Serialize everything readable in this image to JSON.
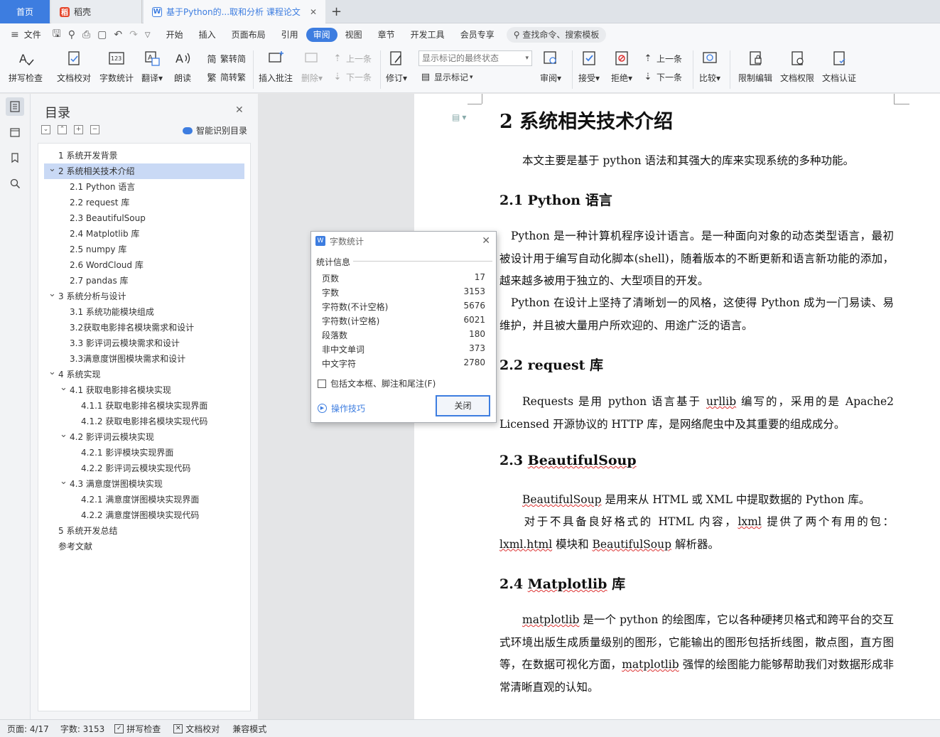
{
  "tabs": {
    "home": "首页",
    "tab1": "稻壳",
    "tab2": "基于Python的...取和分析 课程论文"
  },
  "menu": {
    "file": "文件",
    "items": [
      "开始",
      "插入",
      "页面布局",
      "引用",
      "审阅",
      "视图",
      "章节",
      "开发工具",
      "会员专享"
    ],
    "search": "查找命令、搜索模板"
  },
  "ribbon": {
    "spellcheck": "拼写检查",
    "doccheck": "文档校对",
    "wordcount": "字数统计",
    "translate": "翻译",
    "read": "朗读",
    "trad": "繁转简",
    "simp": "简转繁",
    "insert_comment": "插入批注",
    "delete": "删除",
    "prev": "上一条",
    "next": "下一条",
    "revise": "修订",
    "markup_select": "显示标记的最终状态",
    "show_markup": "显示标记",
    "review": "审阅",
    "accept": "接受",
    "reject": "拒绝",
    "prev2": "上一条",
    "next2": "下一条",
    "compare": "比较",
    "restrict": "限制编辑",
    "permission": "文档权限",
    "certify": "文档认证"
  },
  "toc": {
    "title": "目录",
    "smart": "智能识别目录",
    "items": [
      {
        "label": "1 系统开发背景",
        "level": 0,
        "chev": false
      },
      {
        "label": "2 系统相关技术介绍",
        "level": 0,
        "chev": true,
        "selected": true
      },
      {
        "label": "2.1 Python 语言",
        "level": 1,
        "chev": false
      },
      {
        "label": "2.2 request 库",
        "level": 1,
        "chev": false
      },
      {
        "label": "2.3 BeautifulSoup",
        "level": 1,
        "chev": false
      },
      {
        "label": "2.4 Matplotlib 库",
        "level": 1,
        "chev": false
      },
      {
        "label": "2.5 numpy 库",
        "level": 1,
        "chev": false
      },
      {
        "label": "2.6 WordCloud 库",
        "level": 1,
        "chev": false
      },
      {
        "label": "2.7 pandas 库",
        "level": 1,
        "chev": false
      },
      {
        "label": "3 系统分析与设计",
        "level": 0,
        "chev": true
      },
      {
        "label": "3.1 系统功能模块组成",
        "level": 1,
        "chev": false
      },
      {
        "label": "3.2获取电影排名模块需求和设计",
        "level": 1,
        "chev": false
      },
      {
        "label": "3.3 影评词云模块需求和设计",
        "level": 1,
        "chev": false
      },
      {
        "label": "3.3满意度饼图模块需求和设计",
        "level": 1,
        "chev": false
      },
      {
        "label": "4 系统实现",
        "level": 0,
        "chev": true
      },
      {
        "label": "4.1  获取电影排名模块实现",
        "level": 1,
        "chev": true
      },
      {
        "label": "4.1.1  获取电影排名模块实现界面",
        "level": 2,
        "chev": false
      },
      {
        "label": "4.1.2  获取电影排名模块实现代码",
        "level": 2,
        "chev": false
      },
      {
        "label": "4.2  影评词云模块实现",
        "level": 1,
        "chev": true
      },
      {
        "label": "4.2.1  影评模块实现界面",
        "level": 2,
        "chev": false
      },
      {
        "label": "4.2.2  影评词云模块实现代码",
        "level": 2,
        "chev": false
      },
      {
        "label": "4.3  满意度饼图模块实现",
        "level": 1,
        "chev": true
      },
      {
        "label": "4.2.1  满意度饼图模块实现界面",
        "level": 2,
        "chev": false
      },
      {
        "label": "4.2.2  满意度饼图模块实现代码",
        "level": 2,
        "chev": false
      },
      {
        "label": "5 系统开发总结",
        "level": 0,
        "chev": false
      },
      {
        "label": "参考文献",
        "level": 0,
        "chev": false
      }
    ]
  },
  "doc": {
    "h1": "2 系统相关技术介绍",
    "p0": "本文主要是基于 python 语法和其强大的库来实现系统的多种功能。",
    "h21": "2.1 Python 语言",
    "p1a": "Python 是一种计算机程序设计语言。是一种面向对象的动态类型语言，最初被设计用于编写自动化脚本(shell)，随着版本的不断更新和语言新功能的添加，越来越多被用于独立的、大型项目的开发。",
    "p1b": "Python 在设计上坚持了清晰划一的风格，这使得 Python 成为一门易读、易维护，并且被大量用户所欢迎的、用途广泛的语言。",
    "h22": "2.2 request 库",
    "p2_pre": "Requests 是用 python 语言基于 ",
    "p2_sq": "urllib",
    "p2_post": " 编写的，采用的是 Apache2 Licensed 开源协议的 HTTP 库，是网络爬虫中及其重要的组成成分。",
    "h23_pre": "2.3 ",
    "h23_sq": "BeautifulSoup",
    "p3a_sq": "BeautifulSoup",
    "p3a_post": " 是用来从 HTML 或 XML 中提取数据的 Python 库。",
    "p3b_1": "对于不具备良好格式的  HTML  内容，",
    "p3b_sq1": "lxml",
    "p3b_2": "  提供了两个有用的包：",
    "p3b_sq2": "lxml.html",
    "p3b_3": " 模块和  ",
    "p3b_sq3": "BeautifulSoup",
    "p3b_4": "  解析器。",
    "h24_pre": "2.4 ",
    "h24_sq": "Matplotlib",
    "h24_post": " 库",
    "p4_sq1": "matplotlib",
    "p4_1": " 是一个 python 的绘图库，它以各种硬拷贝格式和跨平台的交互式环境出版生成质量级别的图形，它能输出的图形包括折线图，散点图，直方图等，在数据可视化方面，",
    "p4_sq2": "matplotlib",
    "p4_2": " 强悍的绘图能力能够帮助我们对数据形成非常清晰直观的认知。"
  },
  "dialog": {
    "title": "字数统计",
    "section": "统计信息",
    "stats": [
      {
        "label": "页数",
        "value": "17"
      },
      {
        "label": "字数",
        "value": "3153"
      },
      {
        "label": "字符数(不计空格)",
        "value": "5676"
      },
      {
        "label": "字符数(计空格)",
        "value": "6021"
      },
      {
        "label": "段落数",
        "value": "180"
      },
      {
        "label": "非中文单词",
        "value": "373"
      },
      {
        "label": "中文字符",
        "value": "2780"
      }
    ],
    "checkbox": "包括文本框、脚注和尾注(F)",
    "tips": "操作技巧",
    "close": "关闭"
  },
  "status": {
    "page": "页面: 4/17",
    "words": "字数: 3153",
    "spell": "拼写检查",
    "proof": "文档校对",
    "compat": "兼容模式"
  },
  "colors": {
    "accent": "#3d7de0",
    "toc_selected": "#c9d9f5"
  }
}
